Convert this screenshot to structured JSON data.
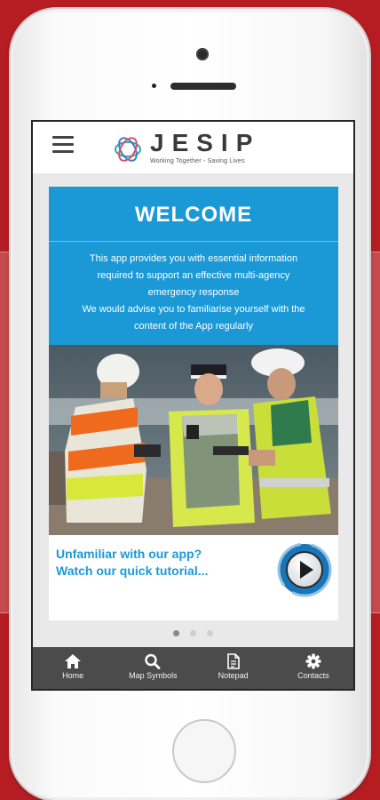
{
  "header": {
    "logo_text": "JESIP",
    "tagline": "Working Together - Saving Lives"
  },
  "welcome": {
    "title": "WELCOME",
    "lines": [
      "This app provides you with essential information",
      "required to support an effective multi-agency",
      "emergency response",
      "We would advise you to familiarise yourself with the",
      "content of the App regularly"
    ]
  },
  "tutorial": {
    "line1": "Unfamiliar with our app?",
    "line2": "Watch our quick tutorial..."
  },
  "carousel": {
    "pages": 3,
    "active_page": 1
  },
  "tabbar": {
    "items": [
      {
        "label": "Home",
        "icon": "home-icon"
      },
      {
        "label": "Map Symbols",
        "icon": "search-icon"
      },
      {
        "label": "Notepad",
        "icon": "document-icon"
      },
      {
        "label": "Contacts",
        "icon": "gear-icon"
      }
    ]
  },
  "colors": {
    "accent": "#1a99d6",
    "background": "#b51d23",
    "tabbar": "#4b4b4b"
  }
}
